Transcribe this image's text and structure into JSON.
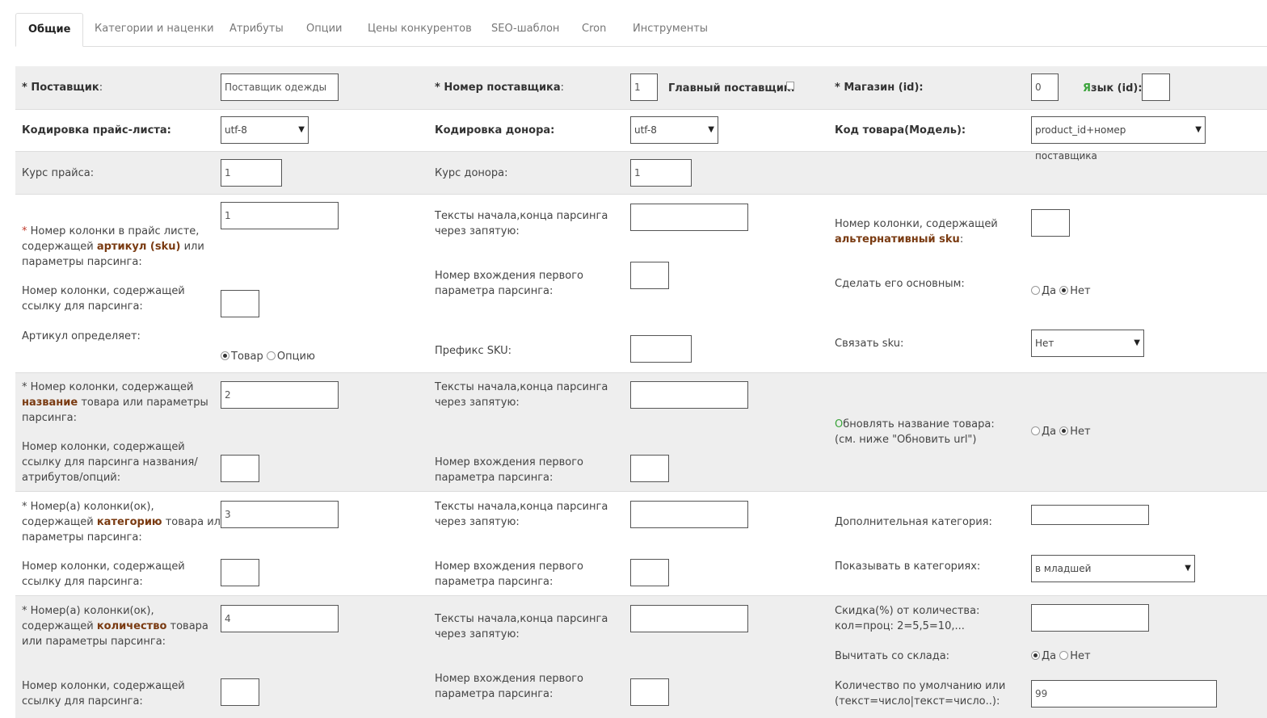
{
  "tabs": [
    "Общие",
    "Категории и наценки",
    "Атрибуты",
    "Опции",
    "Цены конкурентов",
    "SEO-шаблон",
    "Cron",
    "Инструменты"
  ],
  "row1": {
    "supplier_label": "Поставщик",
    "supplier_value": "Поставщик одежды",
    "supplier_num_label": "Номер поставщика",
    "supplier_num_value": "1",
    "main_supplier_label": "Главный поставщик:",
    "store_label": "Магазин (id):",
    "store_value": "0",
    "lang_first": "Я",
    "lang_rest": "зык (id):",
    "lang_value": ""
  },
  "row2": {
    "price_enc_label": "Кодировка прайс-листа:",
    "price_enc_value": "utf-8",
    "donor_enc_label": "Кодировка донора:",
    "donor_enc_value": "utf-8",
    "code_label": "Код товара(Модель):",
    "code_value": "product_id+номер поставщика"
  },
  "row3": {
    "price_rate_label": "Курс прайса:",
    "price_rate_value": "1",
    "donor_rate_label": "Курс донора:",
    "donor_rate_value": "1"
  },
  "sku": {
    "col_label_a": "Номер колонки в прайс листе,",
    "col_label_b": "содержащей ",
    "col_label_bold": "артикул (sku)",
    "col_label_c": " или",
    "col_label_d": "параметры парсинга:",
    "col_value": "1",
    "link_label_a": "Номер колонки, содержащей",
    "link_label_b": "ссылку для парсинга:",
    "defines_label": "Артикул определяет:",
    "opt_product": "Товар",
    "opt_option": "Опцию",
    "texts_label_a": "Тексты начала,конца парсинга",
    "texts_label_b": "через запятую:",
    "entry_label_a": "Номер вхождения первого",
    "entry_label_b": "параметра парсинга:",
    "prefix_label": "Префикс SKU:",
    "alt_label_a": "Номер колонки, содержащей",
    "alt_label_bold": "альтернативный sku",
    "make_main_label": "Сделать его основным:",
    "yes": "Да",
    "no": "Нет",
    "link_sku_label": "Связать sku:",
    "link_sku_value": "Нет"
  },
  "name": {
    "col_label_a": "Номер колонки, содержащей",
    "col_label_bold": "название",
    "col_label_b": " товара или параметры",
    "col_label_c": "парсинга:",
    "col_value": "2",
    "link_label_a": "Номер колонки, содержащей",
    "link_label_b": "ссылку для парсинга названия/",
    "link_label_c": "атрибутов/опций:",
    "update_first": "О",
    "update_rest": "бновлять название товара:",
    "update_note": "(см. ниже \"Обновить url\")"
  },
  "category": {
    "col_label_a": "Номер(а) колонки(ок),",
    "col_label_b": "содержащей ",
    "col_label_bold": "категорию",
    "col_label_c": " товара или",
    "col_label_d": "параметры парсинга:",
    "col_value": "3",
    "extra_label": "Дополнительная категория:",
    "show_label": "Показывать в категориях:",
    "show_value": "в младшей"
  },
  "quantity": {
    "col_label_a": "Номер(а) колонки(ок),",
    "col_label_b": "содержащей ",
    "col_label_bold": "количество",
    "col_label_c": " товара",
    "col_label_d": "или параметры парсинга:",
    "col_value": "4",
    "discount_label_a": "Скидка(%) от количества:",
    "discount_label_b": "кол=проц: 2=5,5=10,...",
    "subtract_label": "Вычитать со склада:",
    "default_label_a": "Количество по умолчанию или",
    "default_label_b": "(текст=число|текст=число..):",
    "default_value": "99"
  }
}
